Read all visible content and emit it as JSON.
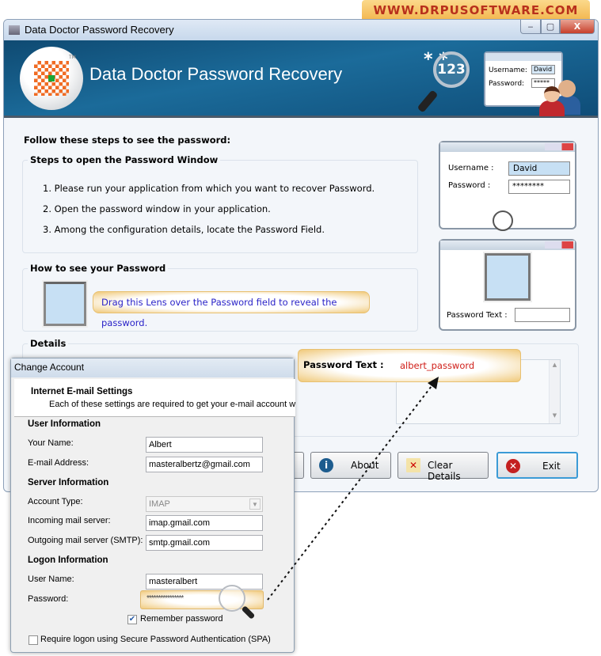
{
  "brand_banner": "WWW.DRPUSOFTWARE.COM",
  "window": {
    "title": "Data Doctor Password Recovery",
    "controls": {
      "minimize": "‒",
      "maximize": "▢",
      "close": "X"
    }
  },
  "banner": {
    "title": "Data Doctor Password Recovery",
    "logo_tm": "TM",
    "stars_text": "* *",
    "lens_text": "123",
    "mini_form": {
      "username_label": "Username:",
      "username_value": "David",
      "password_label": "Password:",
      "password_value": "*****"
    }
  },
  "main": {
    "heading": "Follow these steps to see the password:",
    "steps_group": {
      "legend": "Steps to open the Password Window",
      "steps": [
        "1.  Please run your application from which you want to recover Password.",
        "2.  Open the password window in your application.",
        "3.  Among the configuration details, locate the Password Field."
      ]
    },
    "howto_group": {
      "legend": "How to see your Password",
      "tip": "Drag this Lens over the Password field to reveal the password."
    },
    "details_group": {
      "legend": "Details",
      "password_text_label": "Password Text :",
      "password_text_value": "albert_password"
    }
  },
  "illustration": {
    "login_window": {
      "username_label": "Username :",
      "username_value": "David",
      "password_label": "Password  :",
      "password_value": "********"
    },
    "result_window": {
      "password_text_label": "Password Text :",
      "password_text_value": ""
    }
  },
  "buttons": {
    "about": "About",
    "clear": "Clear Details",
    "exit": "Exit"
  },
  "change_account": {
    "title": "Change Account",
    "header_title": "Internet E-mail Settings",
    "header_subtitle": "Each of these settings are required to get your e-mail account w",
    "user_info": {
      "section": "User Information",
      "name_label": "Your Name:",
      "name_value": "Albert",
      "email_label": "E-mail Address:",
      "email_value": "masteralbertz@gmail.com"
    },
    "server_info": {
      "section": "Server Information",
      "account_type_label": "Account Type:",
      "account_type_value": "IMAP",
      "incoming_label": "Incoming mail server:",
      "incoming_value": "imap.gmail.com",
      "outgoing_label": "Outgoing mail server (SMTP):",
      "outgoing_value": "smtp.gmail.com"
    },
    "logon_info": {
      "section": "Logon Information",
      "username_label": "User Name:",
      "username_value": "masteralbert",
      "password_label": "Password:",
      "password_value": "****************",
      "remember_label": "Remember password",
      "remember_checked": true,
      "spa_label": "Require logon using Secure Password Authentication (SPA)",
      "spa_checked": false
    }
  }
}
